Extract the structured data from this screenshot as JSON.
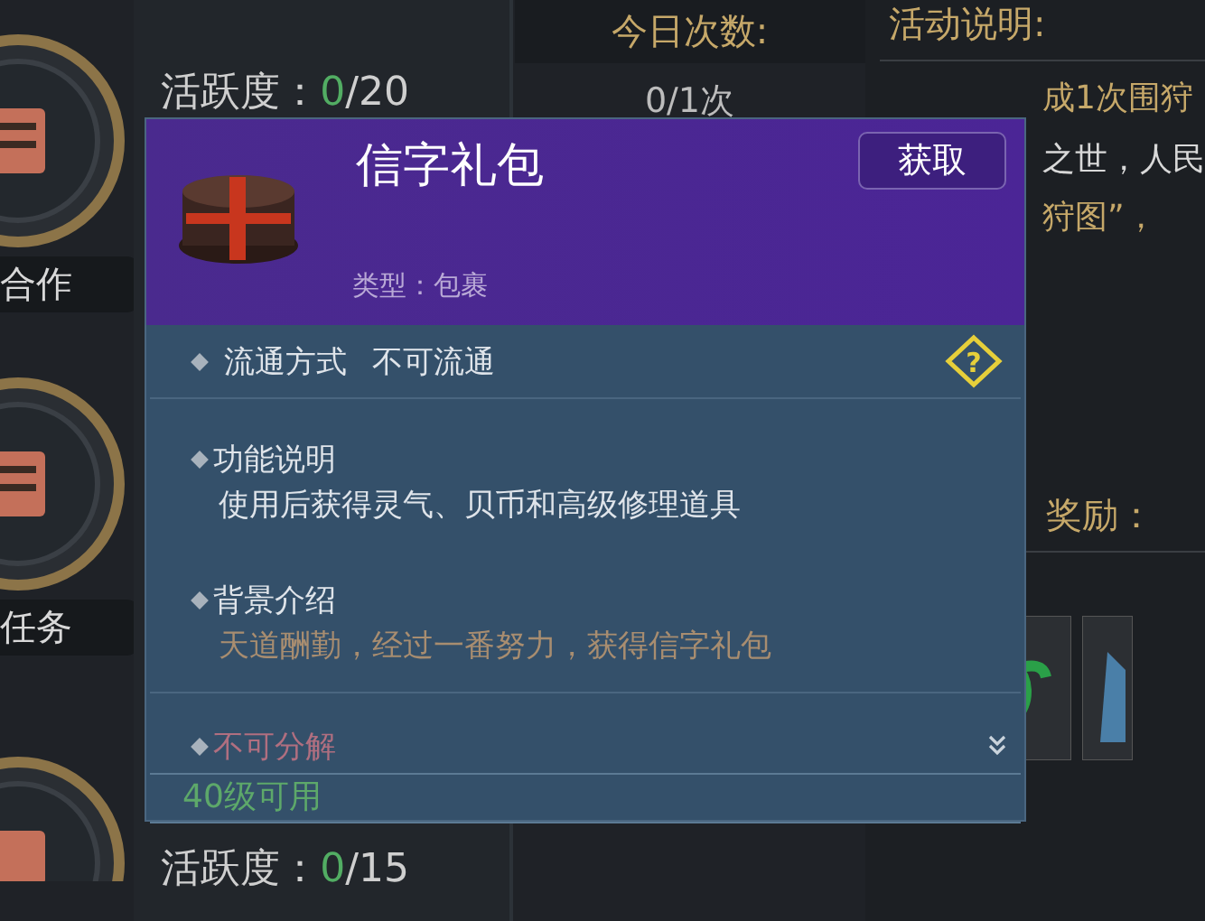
{
  "side_tasks": [
    {
      "label": "合作"
    },
    {
      "label": "任务"
    }
  ],
  "activity": [
    {
      "label": "活跃度：",
      "current": "0",
      "total": "/20"
    },
    {
      "label": "活跃度：",
      "current": "0",
      "total": "/15"
    }
  ],
  "count": {
    "label": "今日次数:",
    "value": "0/1次"
  },
  "description": {
    "title": "活动说明:",
    "lines": [
      {
        "text": "成1次围狩",
        "kind": "highlight"
      },
      {
        "text": "之世，人民",
        "kind": "plain"
      },
      {
        "text": "狩图”，",
        "kind": "highlight"
      }
    ]
  },
  "rewards": {
    "title": "奖励："
  },
  "popup": {
    "name": "信字礼包",
    "type": "类型：包裹",
    "get_button": "获取",
    "circulation": {
      "label": "流通方式",
      "value": "不可流通",
      "help": "?"
    },
    "sections": [
      {
        "title": "功能说明",
        "text": "使用后获得灵气、贝币和高级修理道具",
        "kind": "plain"
      },
      {
        "title": "背景介绍",
        "text": "天道酬勤，经过一番努力，获得信字礼包",
        "kind": "lore"
      }
    ],
    "decompose": "不可分解",
    "level_requirement": "40级可用"
  }
}
